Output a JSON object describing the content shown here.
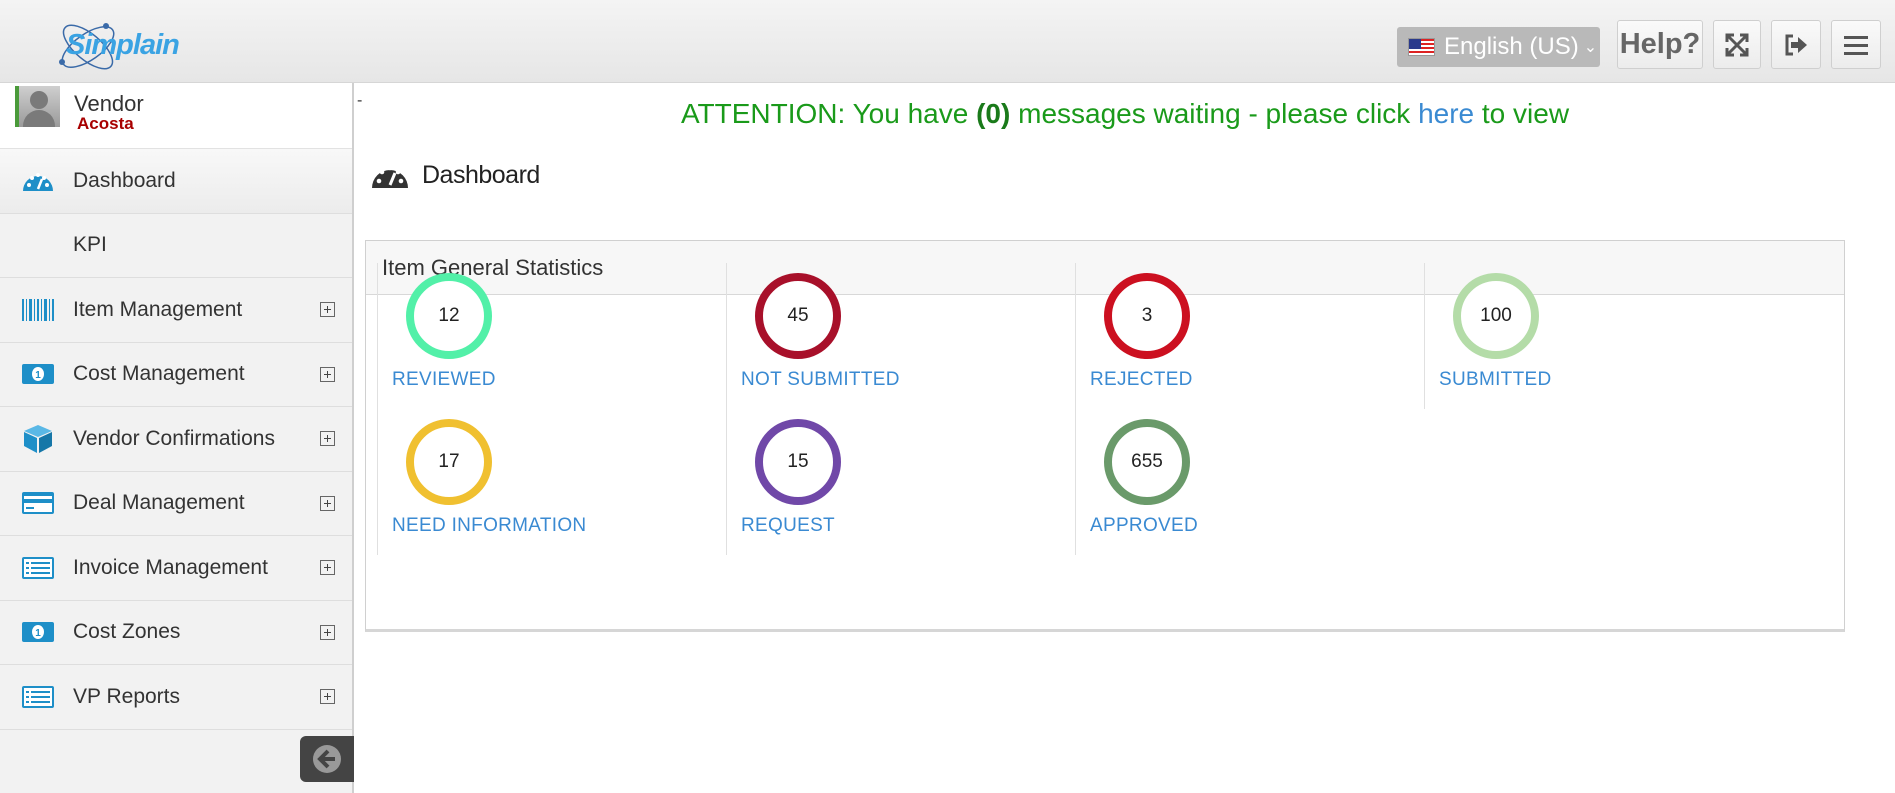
{
  "header": {
    "logo_text": "Simplain",
    "language": "English (US)",
    "help_label": "Help?"
  },
  "user": {
    "role": "Vendor",
    "name": "Acosta"
  },
  "sidebar": {
    "items": [
      {
        "label": "Dashboard",
        "icon": "dashboard-icon"
      },
      {
        "label": "KPI"
      },
      {
        "label": "Item Management",
        "icon": "barcode-icon"
      },
      {
        "label": "Cost Management",
        "icon": "money-icon"
      },
      {
        "label": "Vendor Confirmations",
        "icon": "box-icon"
      },
      {
        "label": "Deal Management",
        "icon": "credit-card-icon"
      },
      {
        "label": "Invoice Management",
        "icon": "list-icon"
      },
      {
        "label": "Cost Zones",
        "icon": "money-icon"
      },
      {
        "label": "VP Reports",
        "icon": "list-icon"
      }
    ]
  },
  "main": {
    "dash_mark": "-",
    "attention": {
      "prefix": "ATTENTION: You have",
      "count": "(0)",
      "middle": "messages waiting - please click",
      "link": "here",
      "suffix": "to view"
    },
    "page_title": "Dashboard",
    "panel_title": "Item General Statistics",
    "stats": [
      {
        "value": "12",
        "label": "REVIEWED",
        "color": "#52f0a8"
      },
      {
        "value": "45",
        "label": "NOT SUBMITTED",
        "color": "#a8102a"
      },
      {
        "value": "3",
        "label": "REJECTED",
        "color": "#cc1020"
      },
      {
        "value": "100",
        "label": "SUBMITTED",
        "color": "#b4dca8"
      },
      {
        "value": "17",
        "label": "NEED INFORMATION",
        "color": "#f0c030"
      },
      {
        "value": "15",
        "label": "REQUEST",
        "color": "#7048a8"
      },
      {
        "value": "655",
        "label": "APPROVED",
        "color": "#6a9a6a"
      }
    ]
  },
  "colors": {
    "link": "#3a8ad2",
    "attention": "#1a9a1a",
    "icon_blue": "#1e8fc8"
  }
}
